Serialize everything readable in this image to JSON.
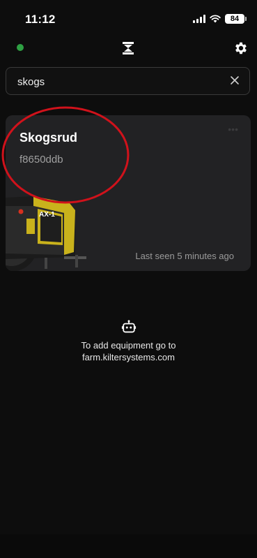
{
  "status_bar": {
    "time": "11:12",
    "battery": "84"
  },
  "header": {
    "status_color": "#2ea043",
    "logo_icon": "hourglass-logo-icon",
    "settings_icon": "gear-icon"
  },
  "search": {
    "value": "skogs",
    "clear_icon": "close-icon"
  },
  "equipment": [
    {
      "name": "Skogsrud",
      "id": "f8650ddb",
      "last_seen": "Last seen 5 minutes ago",
      "model_label": "AX-1",
      "annotation_color": "#d0121b"
    }
  ],
  "empty_hint": {
    "icon": "robot-icon",
    "line1": "To add equipment go to",
    "line2": "farm.kiltersystems.com"
  }
}
